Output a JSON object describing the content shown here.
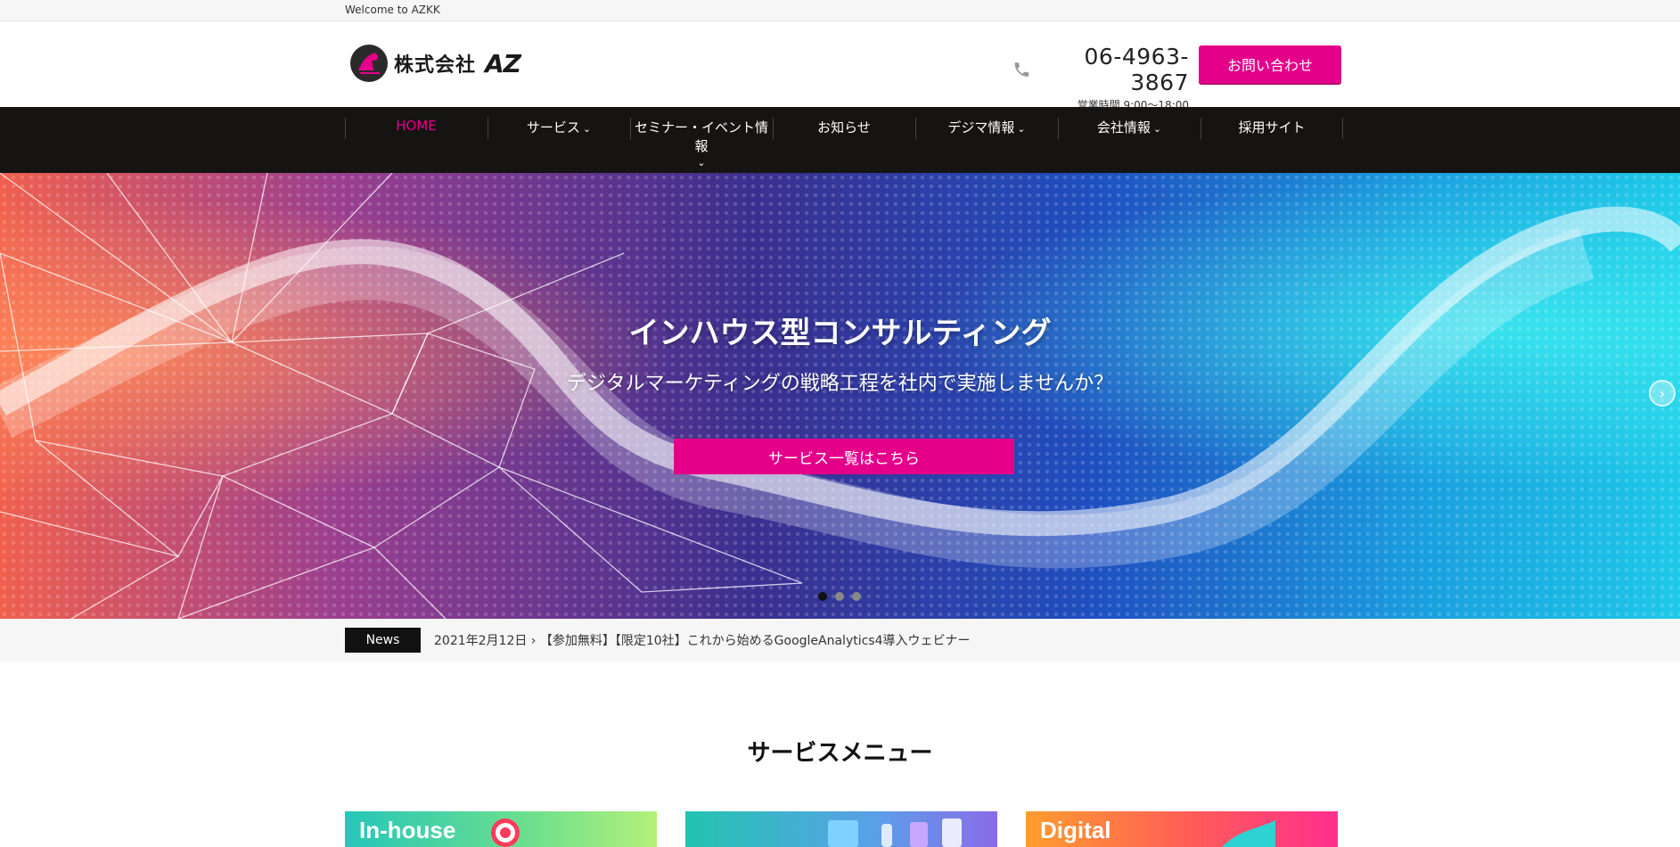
{
  "topbar": {
    "welcome": "Welcome to AZKK"
  },
  "header": {
    "logo_text": "株式会社",
    "logo_mark_text": "AZ",
    "phone": "06-4963-3867",
    "hours": "営業時間 9:00～18:00",
    "contact_label": "お問い合わせ"
  },
  "nav": {
    "items": [
      {
        "label": "HOME",
        "active": true
      },
      {
        "label": "サービス",
        "dropdown": true
      },
      {
        "label": "セミナー・イベント情報",
        "dropdown": true
      },
      {
        "label": "お知らせ"
      },
      {
        "label": "デジマ情報",
        "dropdown": true
      },
      {
        "label": "会社情報",
        "dropdown": true
      },
      {
        "label": "採用サイト"
      }
    ]
  },
  "hero": {
    "title": "インハウス型コンサルティング",
    "subtitle": "デジタルマーケティングの戦略工程を社内で実施しませんか？",
    "button_label": "サービス一覧はこちら",
    "slide_count": 3,
    "active_slide": 1,
    "next_icon": "chevron-right-icon"
  },
  "news": {
    "label": "News",
    "item": "2021年2月12日 › 【参加無料】【限定10社】これから始めるGoogleAnalytics4導入ウェビナー"
  },
  "services": {
    "title": "サービスメニュー",
    "cards": [
      {
        "label": "In-house"
      },
      {
        "label": ""
      },
      {
        "label": "Digital"
      }
    ]
  },
  "colors": {
    "accent": "#e5008a",
    "nav_bg": "#161412",
    "topbar_bg": "#f6f6f6"
  }
}
